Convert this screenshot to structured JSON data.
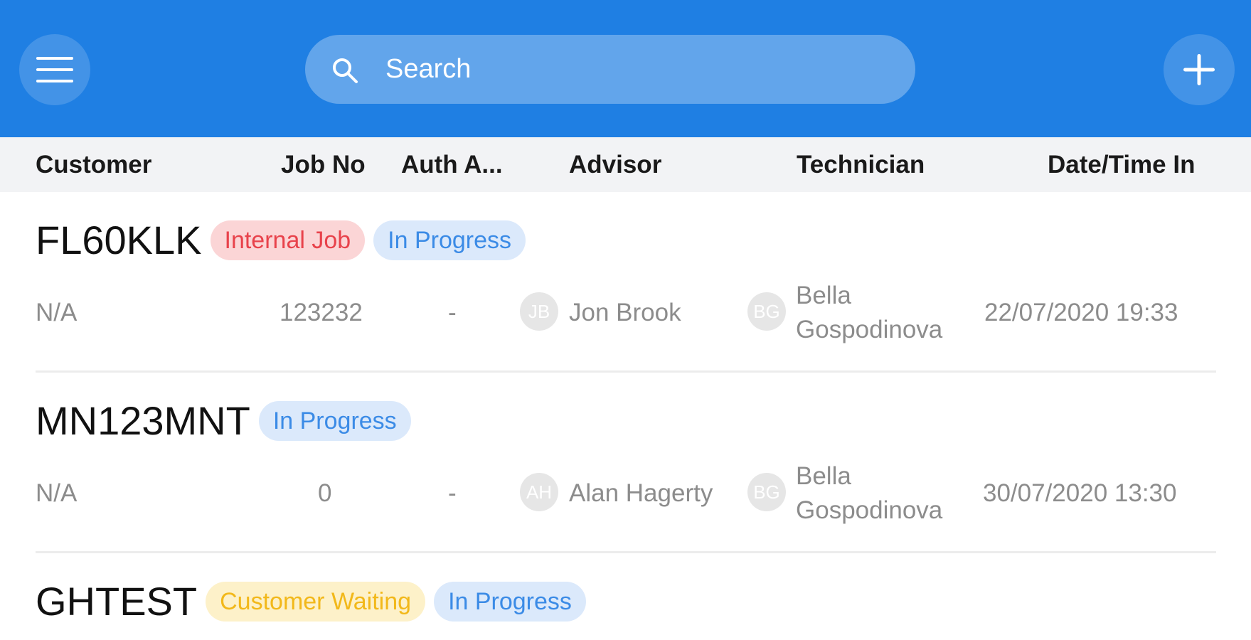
{
  "search": {
    "placeholder": "Search"
  },
  "icons": {
    "menu": "menu-icon",
    "search": "search-icon",
    "add": "plus-icon"
  },
  "colors": {
    "header": "#1f7fe3",
    "internal_job": "#e8424b",
    "in_progress": "#3b8be6",
    "customer_waiting": "#f2b81a"
  },
  "columns": [
    "Customer",
    "Job No",
    "Auth A...",
    "Advisor",
    "Technician",
    "Date/Time In"
  ],
  "jobs": [
    {
      "plate": "FL60KLK",
      "badges": [
        "Internal Job",
        "In Progress"
      ],
      "customer": "N/A",
      "job_no": "123232",
      "auth": "-",
      "advisor_initials": "JB",
      "advisor": "Jon Brook",
      "technician_initials": "BG",
      "technician_first": "Bella",
      "technician_last": "Gospodinova",
      "date_time_in": "22/07/2020 19:33"
    },
    {
      "plate": "MN123MNT",
      "badges": [
        "In Progress"
      ],
      "customer": "N/A",
      "job_no": "0",
      "auth": "-",
      "advisor_initials": "AH",
      "advisor": "Alan Hagerty",
      "technician_initials": "BG",
      "technician_first": "Bella",
      "technician_last": "Gospodinova",
      "date_time_in": "30/07/2020 13:30"
    },
    {
      "plate": "GHTEST",
      "badges": [
        "Customer Waiting",
        "In Progress"
      ]
    }
  ]
}
